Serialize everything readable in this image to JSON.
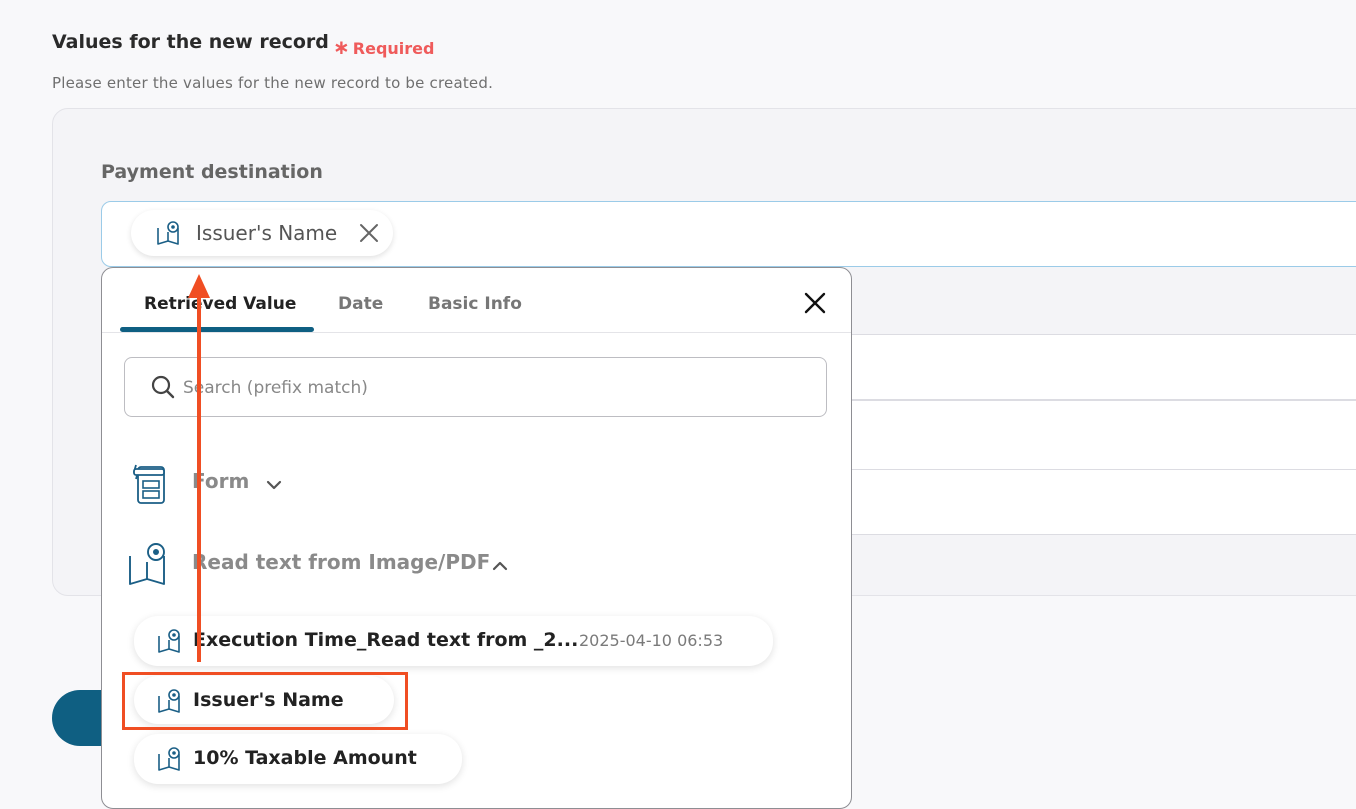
{
  "section": {
    "title": "Values for the new record",
    "required_label": "Required",
    "description": "Please enter the values for the new record to be created."
  },
  "field": {
    "label": "Payment destination",
    "chip_label": "Issuer's Name"
  },
  "dropdown": {
    "tabs": [
      {
        "label": "Retrieved Value",
        "active": true
      },
      {
        "label": "Date",
        "active": false
      },
      {
        "label": "Basic Info",
        "active": false
      }
    ],
    "search_placeholder": "Search (prefix match)",
    "groups": [
      {
        "label": "Form",
        "expanded": false,
        "icon": "form-icon"
      },
      {
        "label": "Read text from Image/PDF",
        "expanded": true,
        "icon": "ocr-book-icon"
      }
    ],
    "items": [
      {
        "label": "Execution Time_Read text from _2...",
        "meta": "2025-04-10 06:53"
      },
      {
        "label": "Issuer's Name",
        "meta": ""
      },
      {
        "label": "10% Taxable Amount",
        "meta": ""
      }
    ]
  },
  "colors": {
    "accent": "#0f5f82",
    "required": "#ef5b5b",
    "annotation": "#f04e23",
    "input_border": "#9bcbe8"
  }
}
